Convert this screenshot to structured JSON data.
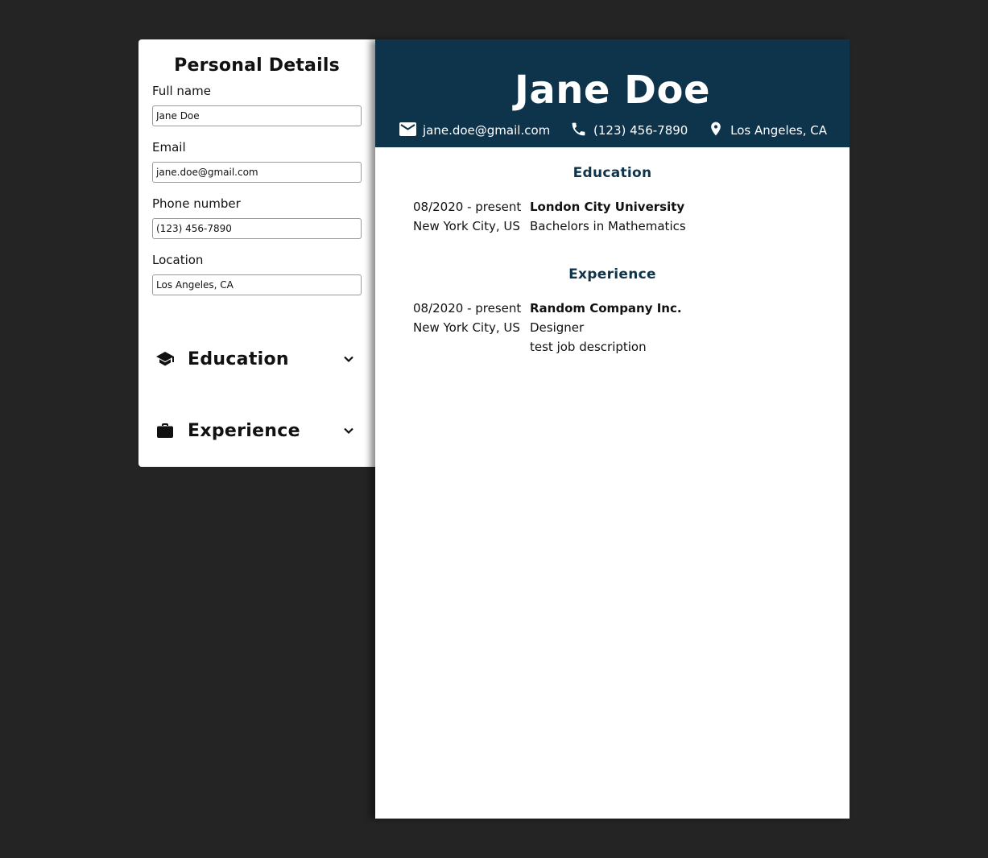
{
  "editor": {
    "title": "Personal Details",
    "fields": [
      {
        "label": "Full name",
        "value": "Jane Doe"
      },
      {
        "label": "Email",
        "value": "jane.doe@gmail.com"
      },
      {
        "label": "Phone number",
        "value": "(123) 456-7890"
      },
      {
        "label": "Location",
        "value": "Los Angeles, CA"
      }
    ],
    "sections": [
      {
        "title": "Education",
        "icon": "graduation-cap-icon"
      },
      {
        "title": "Experience",
        "icon": "briefcase-icon"
      }
    ]
  },
  "resume": {
    "name": "Jane Doe",
    "email": "jane.doe@gmail.com",
    "phone": "(123) 456-7890",
    "location": "Los Angeles, CA",
    "header_color": "#0e344c",
    "education": {
      "title": "Education",
      "entries": [
        {
          "dates": "08/2020 - present",
          "place": "New York City, US",
          "school": "London City University",
          "degree": "Bachelors in Mathematics"
        }
      ]
    },
    "experience": {
      "title": "Experience",
      "entries": [
        {
          "dates": "08/2020 - present",
          "place": "New York City, US",
          "company": "Random Company Inc.",
          "position": "Designer",
          "description": "test job description"
        }
      ]
    }
  }
}
